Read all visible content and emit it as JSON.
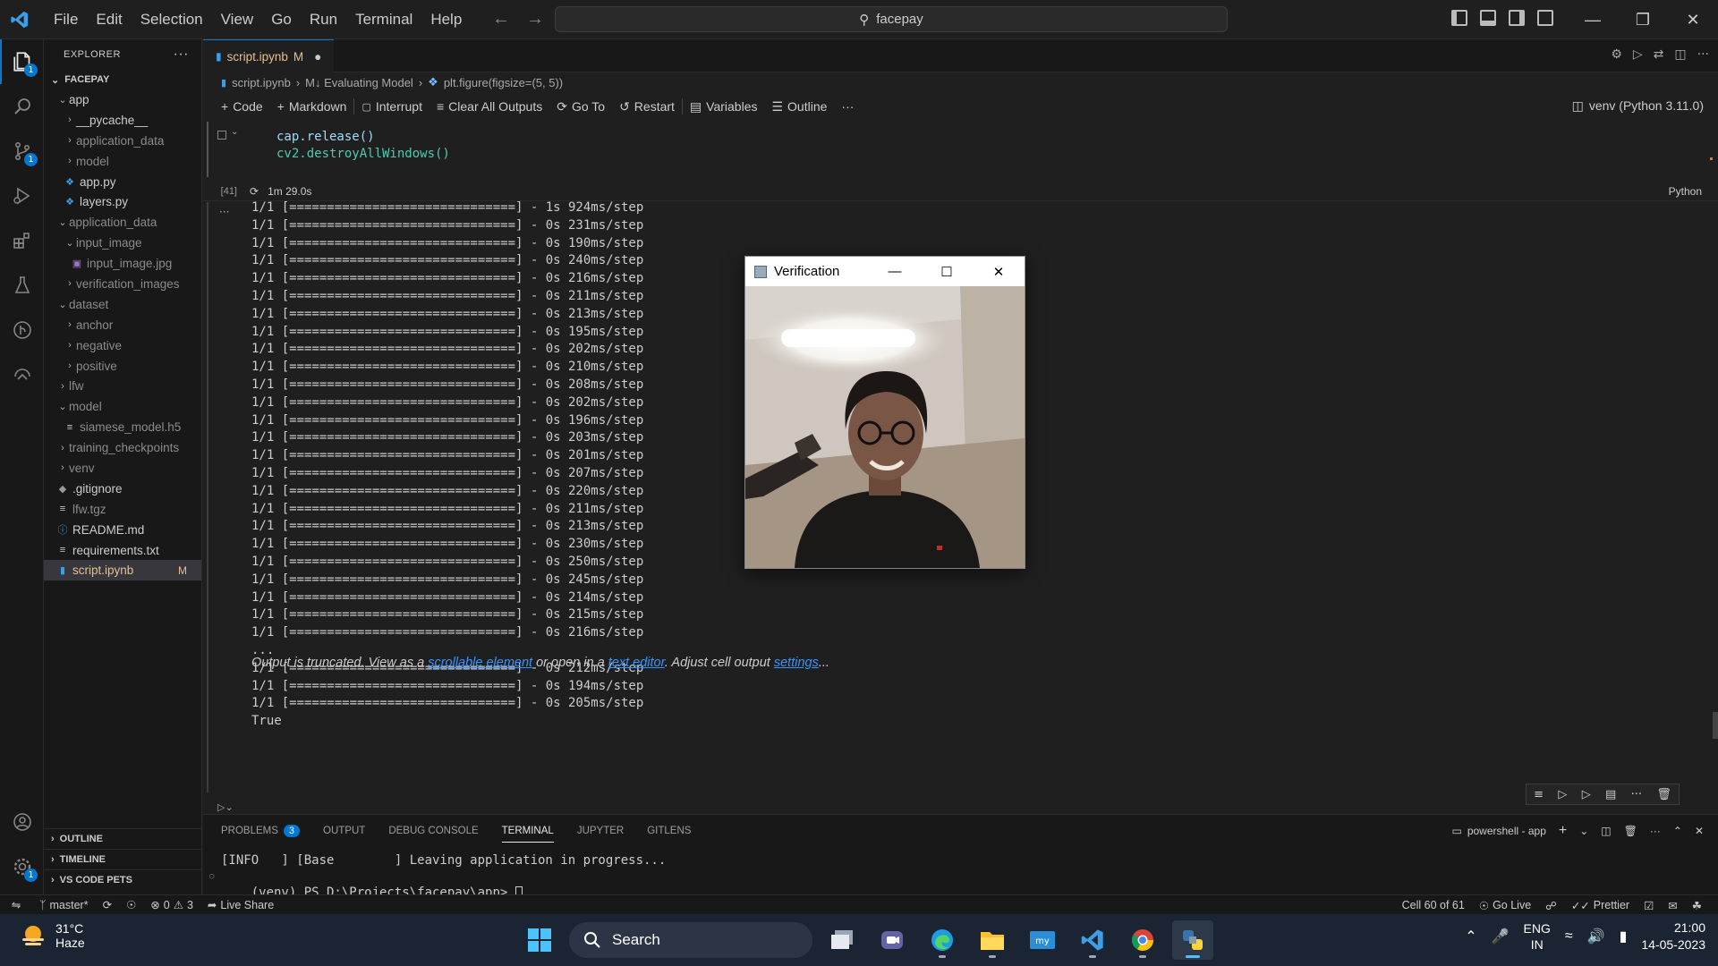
{
  "titlebar": {
    "menu": [
      "File",
      "Edit",
      "Selection",
      "View",
      "Go",
      "Run",
      "Terminal",
      "Help"
    ],
    "search": "facepay"
  },
  "activity_bar": {
    "items": [
      "explorer-icon",
      "search-icon",
      "source-control-icon",
      "run-debug-icon",
      "extensions-icon",
      "testing-icon",
      "gitlens-icon",
      "remote-explorer-icon"
    ],
    "explorer_badge": "1",
    "scm_badge": "1",
    "settings_badge": "1"
  },
  "sidebar": {
    "title": "EXPLORER",
    "root": "FACEPAY",
    "tree": [
      {
        "label": "app",
        "type": "folder",
        "open": true,
        "depth": 1
      },
      {
        "label": "__pycache__",
        "type": "folder",
        "open": false,
        "depth": 2
      },
      {
        "label": "application_data",
        "type": "folder",
        "open": false,
        "depth": 2,
        "dim": true
      },
      {
        "label": "model",
        "type": "folder",
        "open": false,
        "depth": 2,
        "dim": true
      },
      {
        "label": "app.py",
        "type": "py",
        "depth": 2
      },
      {
        "label": "layers.py",
        "type": "py",
        "depth": 2
      },
      {
        "label": "application_data",
        "type": "folder",
        "open": true,
        "depth": 1,
        "dim": true
      },
      {
        "label": "input_image",
        "type": "folder",
        "open": true,
        "depth": 2,
        "dim": true
      },
      {
        "label": "input_image.jpg",
        "type": "img",
        "depth": 3,
        "dim": true
      },
      {
        "label": "verification_images",
        "type": "folder",
        "open": false,
        "depth": 2,
        "dim": true
      },
      {
        "label": "dataset",
        "type": "folder",
        "open": true,
        "depth": 1,
        "dim": true
      },
      {
        "label": "anchor",
        "type": "folder",
        "open": false,
        "depth": 2,
        "dim": true
      },
      {
        "label": "negative",
        "type": "folder",
        "open": false,
        "depth": 2,
        "dim": true
      },
      {
        "label": "positive",
        "type": "folder",
        "open": false,
        "depth": 2,
        "dim": true
      },
      {
        "label": "lfw",
        "type": "folder",
        "open": false,
        "depth": 1,
        "dim": true
      },
      {
        "label": "model",
        "type": "folder",
        "open": true,
        "depth": 1,
        "dim": true
      },
      {
        "label": "siamese_model.h5",
        "type": "file",
        "depth": 2,
        "dim": true
      },
      {
        "label": "training_checkpoints",
        "type": "folder",
        "open": false,
        "depth": 1,
        "dim": true
      },
      {
        "label": "venv",
        "type": "folder",
        "open": false,
        "depth": 1,
        "dim": true
      },
      {
        "label": ".gitignore",
        "type": "git",
        "depth": 1
      },
      {
        "label": "lfw.tgz",
        "type": "file",
        "depth": 1,
        "dim": true
      },
      {
        "label": "README.md",
        "type": "info",
        "depth": 1
      },
      {
        "label": "requirements.txt",
        "type": "file",
        "depth": 1
      },
      {
        "label": "script.ipynb",
        "type": "nb",
        "depth": 1,
        "selected": true,
        "modified": "M"
      }
    ],
    "sections": [
      "OUTLINE",
      "TIMELINE",
      "VS CODE PETS"
    ]
  },
  "editor": {
    "tab": {
      "label": "script.ipynb",
      "status": "M"
    },
    "breadcrumb": [
      "script.ipynb",
      "M↓ Evaluating Model",
      "plt.figure(figsize=(5, 5))"
    ],
    "toolbar": [
      "Code",
      "Markdown",
      "Interrupt",
      "Clear All Outputs",
      "Go To",
      "Restart",
      "Variables",
      "Outline"
    ],
    "kernel": "venv (Python 3.11.0)",
    "code": [
      "cap.release()",
      "cv2.destroyAllWindows()"
    ],
    "exec_count": "[41]",
    "exec_time": "1m 29.0s",
    "language": "Python",
    "output_lines": [
      "1/1 [==============================] - 1s 924ms/step",
      "1/1 [==============================] - 0s 231ms/step",
      "1/1 [==============================] - 0s 190ms/step",
      "1/1 [==============================] - 0s 240ms/step",
      "1/1 [==============================] - 0s 216ms/step",
      "1/1 [==============================] - 0s 211ms/step",
      "1/1 [==============================] - 0s 213ms/step",
      "1/1 [==============================] - 0s 195ms/step",
      "1/1 [==============================] - 0s 202ms/step",
      "1/1 [==============================] - 0s 210ms/step",
      "1/1 [==============================] - 0s 208ms/step",
      "1/1 [==============================] - 0s 202ms/step",
      "1/1 [==============================] - 0s 196ms/step",
      "1/1 [==============================] - 0s 203ms/step",
      "1/1 [==============================] - 0s 201ms/step",
      "1/1 [==============================] - 0s 207ms/step",
      "1/1 [==============================] - 0s 220ms/step",
      "1/1 [==============================] - 0s 211ms/step",
      "1/1 [==============================] - 0s 213ms/step",
      "1/1 [==============================] - 0s 230ms/step",
      "1/1 [==============================] - 0s 250ms/step",
      "1/1 [==============================] - 0s 245ms/step",
      "1/1 [==============================] - 0s 214ms/step",
      "1/1 [==============================] - 0s 215ms/step",
      "1/1 [==============================] - 0s 216ms/step",
      "...",
      "1/1 [==============================] - 0s 212ms/step",
      "1/1 [==============================] - 0s 194ms/step",
      "1/1 [==============================] - 0s 205ms/step",
      "True"
    ],
    "truncated": {
      "prefix": "Output is truncated. View as a ",
      "link1": "scrollable element",
      "mid": " or open in a ",
      "link2": "text editor",
      "mid2": ". Adjust cell output ",
      "link3": "settings",
      "suffix": "..."
    }
  },
  "verification_window": {
    "title": "Verification"
  },
  "panel": {
    "tabs": [
      "PROBLEMS",
      "OUTPUT",
      "DEBUG CONSOLE",
      "TERMINAL",
      "JUPYTER",
      "GITLENS"
    ],
    "problems_count": "3",
    "active_tab": "TERMINAL",
    "terminal_name": "powershell - app",
    "terminal_lines": [
      "[INFO   ] [Base        ] Leaving application in progress...",
      "(venv) PS D:\\Projects\\facepay\\app> "
    ]
  },
  "statusbar": {
    "branch": "master*",
    "errors": "0",
    "warnings": "3",
    "live_share": "Live Share",
    "cell": "Cell 60 of 61",
    "go_live": "Go Live",
    "prettier": "Prettier"
  },
  "taskbar": {
    "temp": "31°C",
    "condition": "Haze",
    "search": "Search",
    "lang1": "ENG",
    "lang2": "IN",
    "time": "21:00",
    "date": "14-05-2023"
  },
  "colors": {
    "accent": "#0078d4",
    "modified": "#e2c08d",
    "link": "#3794ff"
  }
}
